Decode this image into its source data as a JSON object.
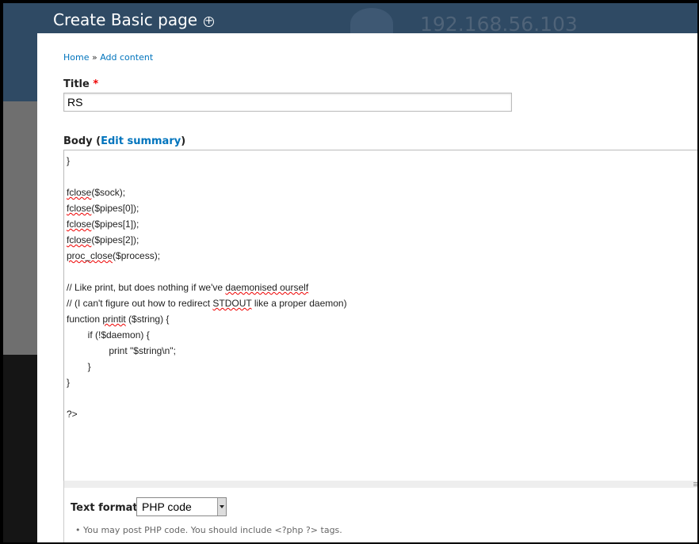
{
  "window": {
    "title": "Create Basic page",
    "ip_text": "192.168.56.103",
    "overlay_icon": "plus-circle-icon"
  },
  "breadcrumb": {
    "home": "Home",
    "sep": "»",
    "current": "Add content"
  },
  "title_field": {
    "label": "Title",
    "required": "*",
    "value": "RS"
  },
  "body_field": {
    "label_prefix": "Body (",
    "edit_summary": "Edit summary",
    "label_suffix": ")"
  },
  "code": [
    {
      "text": "        /"
    },
    {
      "text": "}"
    },
    {
      "text": ""
    },
    {
      "text": "fclose($sock);",
      "misspelled": "fclose"
    },
    {
      "text": "fclose($pipes[0]);",
      "misspelled": "fclose"
    },
    {
      "text": "fclose($pipes[1]);",
      "misspelled": "fclose"
    },
    {
      "text": "fclose($pipes[2]);",
      "misspelled": "fclose"
    },
    {
      "text": "proc_close($process);",
      "misspelled": "proc_close"
    },
    {
      "text": ""
    },
    {
      "text": "// Like print, but does nothing if we've daemonised ourself",
      "misspelled": "daemonised ourself"
    },
    {
      "text": "// (I can't figure out how to redirect STDOUT like a proper daemon)",
      "misspelled": "STDOUT"
    },
    {
      "text": "function printit ($string) {",
      "misspelled": "printit"
    },
    {
      "text": "        if (!$daemon) {"
    },
    {
      "text": "                print \"$string\\n\";"
    },
    {
      "text": "        }"
    },
    {
      "text": "}"
    },
    {
      "text": ""
    },
    {
      "text": "?>"
    }
  ],
  "text_format": {
    "label": "Text format",
    "selected": "PHP code",
    "tip": "You may post PHP code. You should include <?php ?> tags."
  },
  "colors": {
    "link": "#0074bd",
    "header_bg": "#2f4a64",
    "required": "#e00000"
  }
}
